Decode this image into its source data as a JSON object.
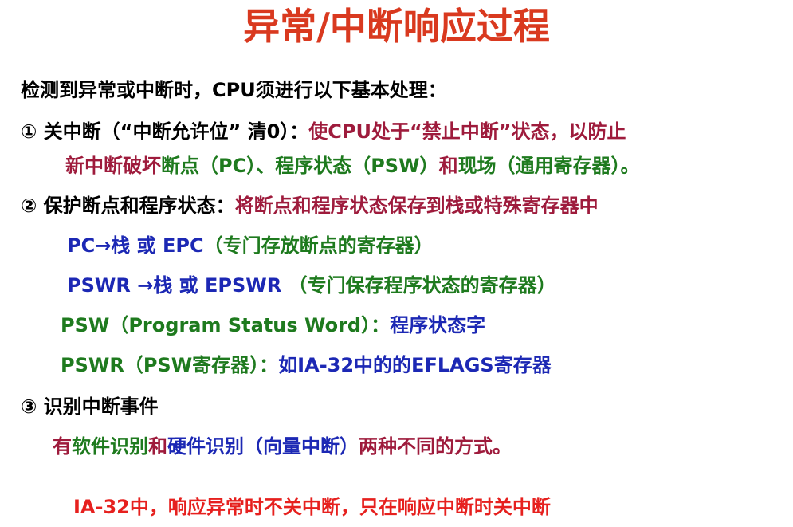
{
  "title": "异常/中断响应过程",
  "intro": "检测到异常或中断时，CPU须进行以下基本处理：",
  "step1": {
    "label": "① 关中断（“中断允许位” 清0）：",
    "text_a": "使CPU处于“禁止中断”状态，以防止",
    "text_b": "新中断破坏",
    "text_c": "断点（PC）、程序状态（PSW）",
    "text_d": "和",
    "text_e": "现场（通用寄存器）。"
  },
  "step2": {
    "label": "② 保护断点和程序状态：",
    "text": "将断点和程序状态保存到栈或特殊寄存器中",
    "pc_a": "PC→栈 或 EPC",
    "pc_b": "（专门存放断点的寄存器）",
    "pswr_a": "PSWR →栈 或 EPSWR ",
    "pswr_b": "（专门保存程序状态的寄存器）",
    "psw_a": "PSW（Program Status Word）：",
    "psw_b": "程序状态字",
    "pswr2_a": "PSWR（PSW寄存器）：",
    "pswr2_b": "如IA-32中的的EFLAGS寄存器"
  },
  "step3": {
    "label": "③ 识别中断事件",
    "t1": "有",
    "t2": "软件识别",
    "t3": "和",
    "t4": "硬件识别（向量中断）",
    "t5": "两种不同的方式。"
  },
  "note": "IA-32中，响应异常时不关中断，只在响应中断时关中断",
  "colors": {
    "title": "#d9391f",
    "dark_red": "#9e1b3c",
    "green": "#1e7a1e",
    "blue": "#1c28b4",
    "red": "#e6201e"
  }
}
